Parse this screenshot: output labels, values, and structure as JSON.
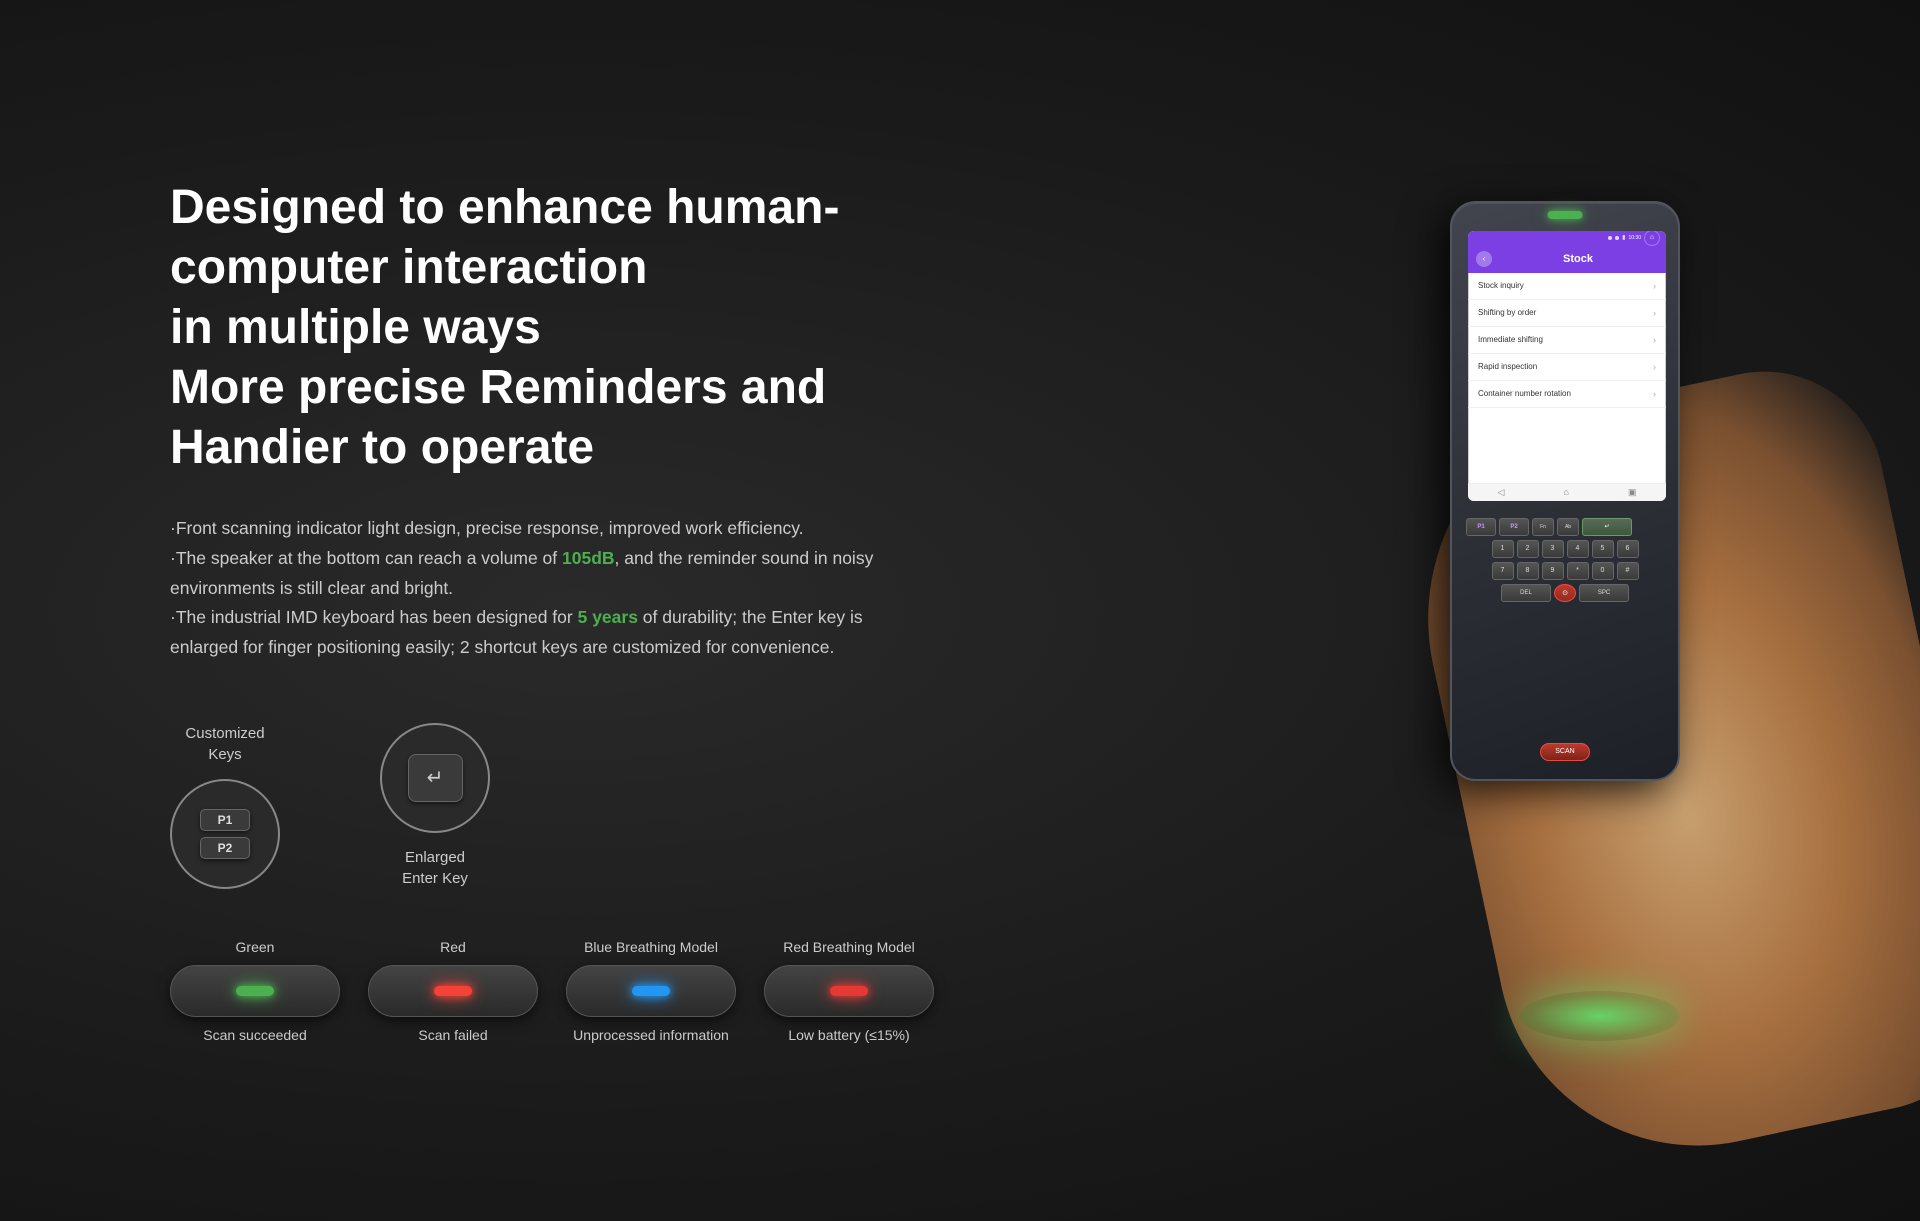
{
  "page": {
    "background": "#1a1a1a"
  },
  "header": {
    "title_line1": "Designed to enhance human-computer interaction",
    "title_line2": "in multiple ways",
    "title_line3": "More precise Reminders and Handier to operate"
  },
  "description": {
    "bullet1": "·Front scanning indicator light design, precise response, improved work efficiency.",
    "bullet2_prefix": "·The speaker at the bottom can reach a volume of ",
    "bullet2_highlight": "105dB",
    "bullet2_suffix": ", and the reminder sound in noisy environments is still clear and bright.",
    "bullet3_prefix": "·The industrial IMD keyboard has been designed for ",
    "bullet3_highlight": "5 years",
    "bullet3_suffix": " of durability; the Enter key is enlarged for finger positioning easily; 2 shortcut keys are customized for convenience."
  },
  "keys": [
    {
      "label": "Customized\nKeys",
      "type": "p1p2",
      "p1_text": "P1",
      "p2_text": "P2"
    },
    {
      "label": "Enlarged\nEnter Key",
      "type": "enter",
      "symbol": "↵"
    }
  ],
  "indicators": [
    {
      "label_top": "Green",
      "label_bottom": "Scan succeeded",
      "light_class": "light-green"
    },
    {
      "label_top": "Red",
      "label_bottom": "Scan failed",
      "light_class": "light-red"
    },
    {
      "label_top": "Blue Breathing Model",
      "label_bottom": "Unprocessed information",
      "light_class": "light-blue"
    },
    {
      "label_top": "Red Breathing Model",
      "label_bottom": "Low battery (≤15%)",
      "light_class": "light-red-dim"
    }
  ],
  "phone": {
    "screen_title": "Stock",
    "menu_items": [
      "Stock inquiry",
      "Shifting by order",
      "Immediate shifting",
      "Rapid inspection",
      "Container number rotation"
    ],
    "indicator_color": "green"
  }
}
